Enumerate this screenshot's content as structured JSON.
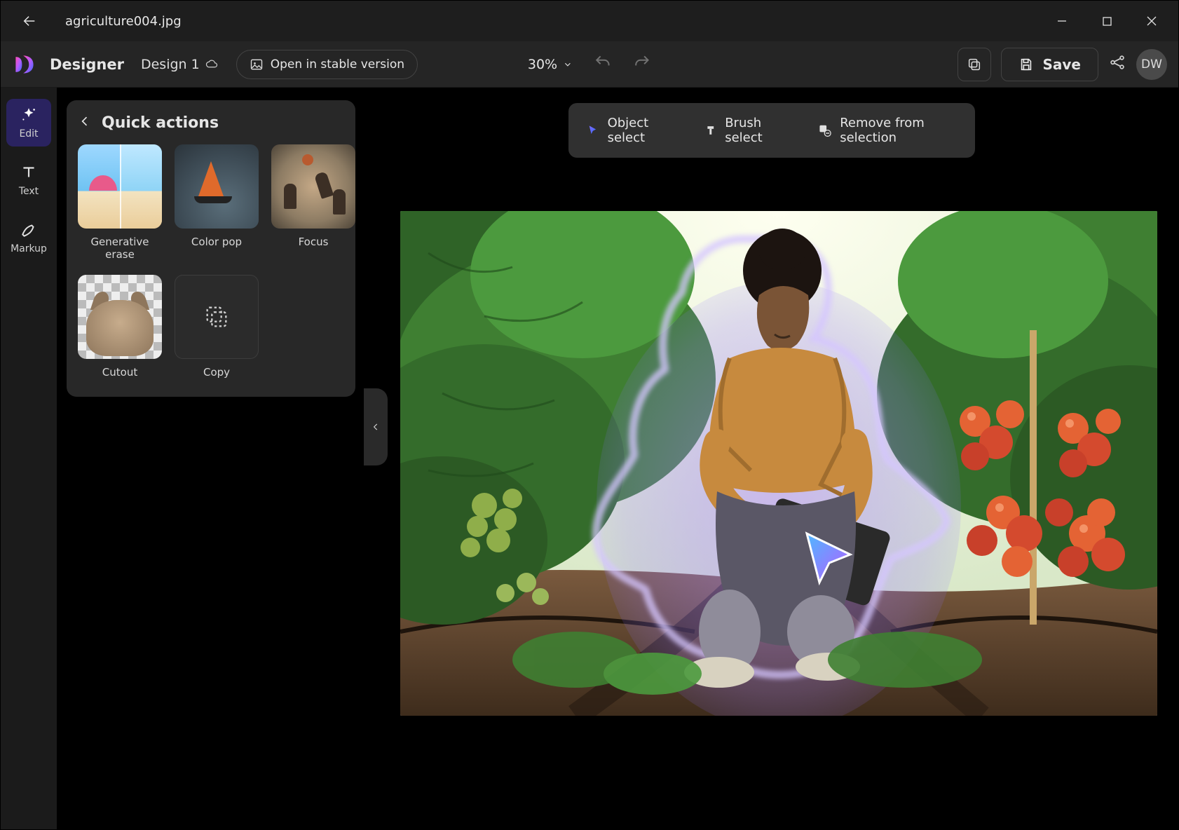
{
  "titlebar": {
    "filename": "agriculture004.jpg"
  },
  "toolbar": {
    "app_name": "Designer",
    "design_label": "Design 1",
    "stable_label": "Open in stable version",
    "zoom": "30%",
    "save_label": "Save",
    "avatar_initials": "DW"
  },
  "rail": {
    "items": [
      {
        "label": "Edit"
      },
      {
        "label": "Text"
      },
      {
        "label": "Markup"
      }
    ]
  },
  "panel": {
    "title": "Quick actions",
    "actions": [
      {
        "label": "Generative erase"
      },
      {
        "label": "Color pop"
      },
      {
        "label": "Focus"
      },
      {
        "label": "Cutout"
      },
      {
        "label": "Copy"
      }
    ]
  },
  "selection_toolbar": {
    "items": [
      {
        "label": "Object select"
      },
      {
        "label": "Brush select"
      },
      {
        "label": "Remove from selection"
      }
    ]
  }
}
